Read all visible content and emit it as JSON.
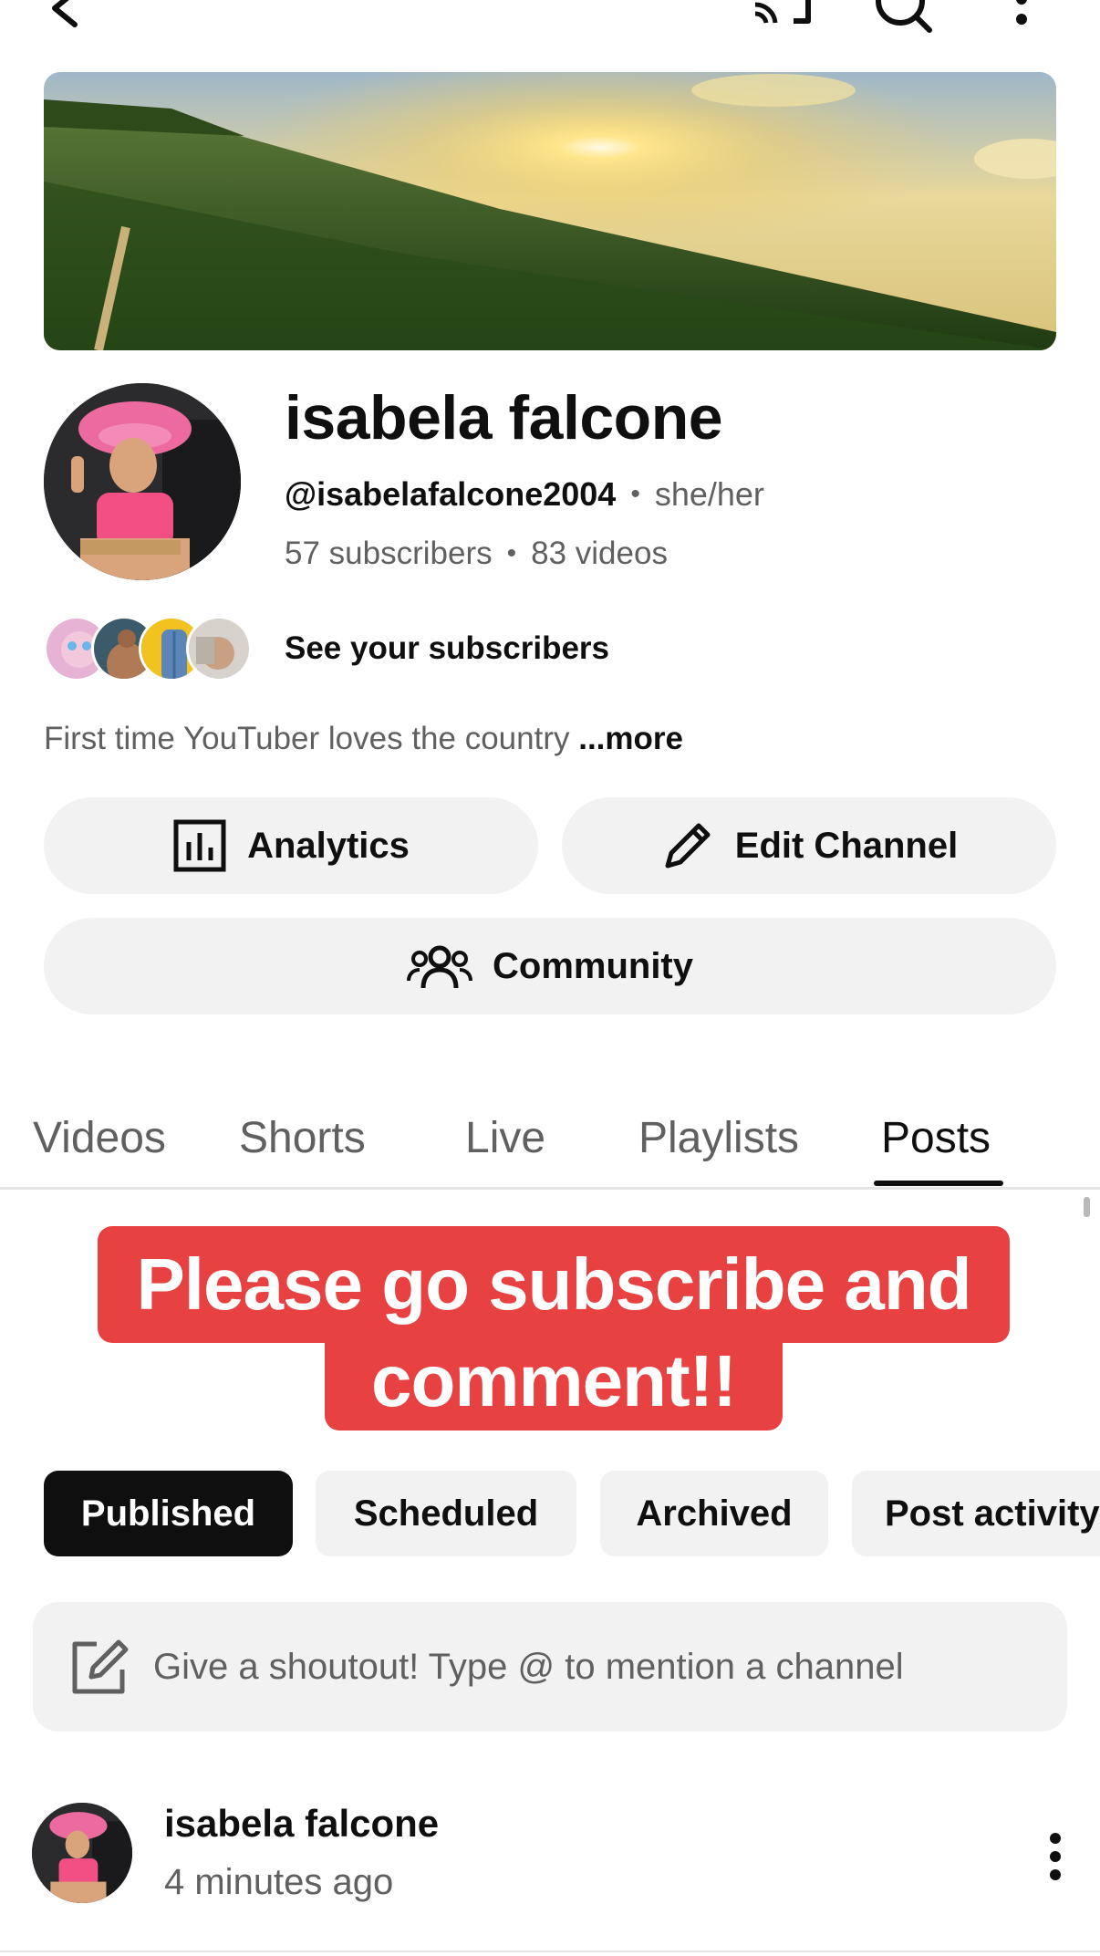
{
  "channel": {
    "name": "isabela falcone",
    "handle": "@isabelafalcone2004",
    "pronouns": "she/her",
    "subscribers": "57 subscribers",
    "videos": "83 videos",
    "see_subscribers": "See your subscribers",
    "description": "First time YouTuber loves the country",
    "more_label": "...more"
  },
  "actions": {
    "analytics": "Analytics",
    "edit_channel": "Edit Channel",
    "community": "Community"
  },
  "tabs": [
    {
      "label": "Videos",
      "active": false
    },
    {
      "label": "Shorts",
      "active": false
    },
    {
      "label": "Live",
      "active": false
    },
    {
      "label": "Playlists",
      "active": false
    },
    {
      "label": "Posts",
      "active": true
    }
  ],
  "promo": {
    "line1": "Please go subscribe and",
    "line2": "comment!!"
  },
  "chips": [
    {
      "label": "Published",
      "active": true
    },
    {
      "label": "Scheduled",
      "active": false
    },
    {
      "label": "Archived",
      "active": false
    },
    {
      "label": "Post activity",
      "active": false
    }
  ],
  "shoutout": {
    "placeholder": "Give a shoutout! Type @ to mention a channel"
  },
  "post": {
    "author": "isabela falcone",
    "time": "4 minutes ago"
  },
  "colors": {
    "accent_red": "#e84141",
    "chip_bg": "#f2f2f2",
    "text_primary": "#0f0f0f",
    "text_secondary": "#606060"
  },
  "icons": {
    "back": "chevron-left-icon",
    "cast": "cast-icon",
    "search": "search-icon",
    "more": "more-vertical-icon",
    "analytics": "bar-chart-icon",
    "edit": "pencil-icon",
    "community": "people-icon",
    "shoutout": "compose-icon"
  }
}
